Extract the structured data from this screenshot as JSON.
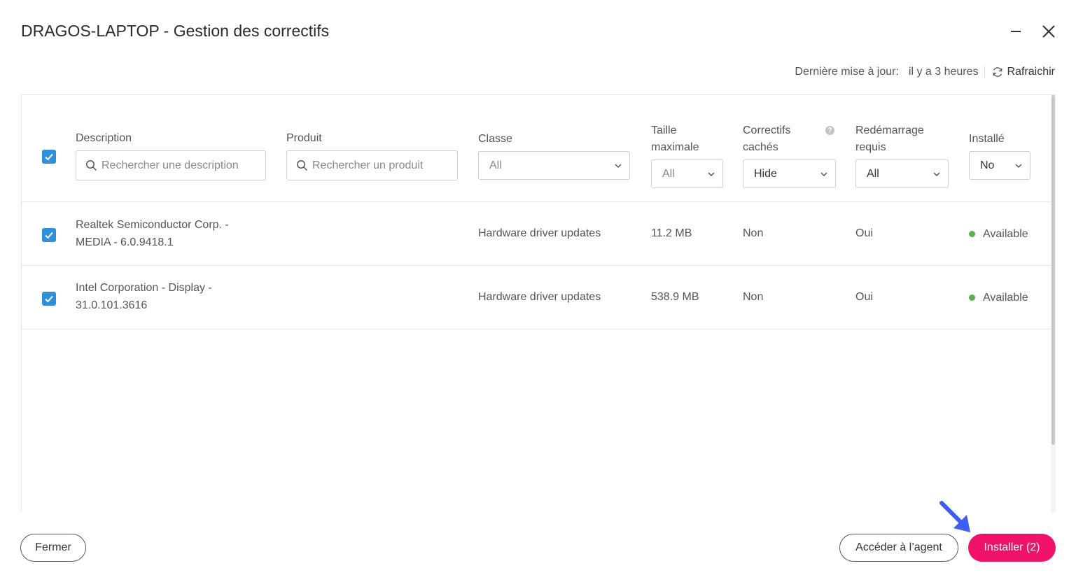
{
  "dialog": {
    "title": "DRAGOS-LAPTOP - Gestion des correctifs",
    "last_update_label": "Dernière mise à jour:",
    "last_update_value": "il y a 3 heures",
    "refresh_label": "Rafraichir"
  },
  "table": {
    "columns": {
      "description": "Description",
      "product": "Produit",
      "class": "Classe",
      "max_size_line1": "Taille",
      "max_size_line2": "maximale",
      "hidden_line1": "Correctifs",
      "hidden_line2": "cachés",
      "restart_line1": "Redémarrage",
      "restart_line2": "requis",
      "installed": "Installé"
    },
    "filters": {
      "description_placeholder": "Rechercher une description",
      "product_placeholder": "Rechercher un produit",
      "class_value": "All",
      "max_size_value": "All",
      "hidden_value": "Hide",
      "restart_value": "All",
      "installed_value": "No"
    },
    "rows": [
      {
        "description_line1": "Realtek Semiconductor Corp. -",
        "description_line2": "MEDIA - 6.0.9418.1",
        "class": "Hardware driver updates",
        "size": "11.2 MB",
        "hidden": "Non",
        "restart": "Oui",
        "status": "Available",
        "checked": true
      },
      {
        "description_line1": "Intel Corporation - Display -",
        "description_line2": "31.0.101.3616",
        "class": "Hardware driver updates",
        "size": "538.9 MB",
        "hidden": "Non",
        "restart": "Oui",
        "status": "Available",
        "checked": true
      }
    ]
  },
  "footer": {
    "close_label": "Fermer",
    "agent_label": "Accéder à l’agent",
    "install_label": "Installer (2)"
  },
  "colors": {
    "primary": "#f0116a",
    "checkbox": "#2f8fd8",
    "available": "#55b54a",
    "arrow": "#3d5ef0"
  }
}
